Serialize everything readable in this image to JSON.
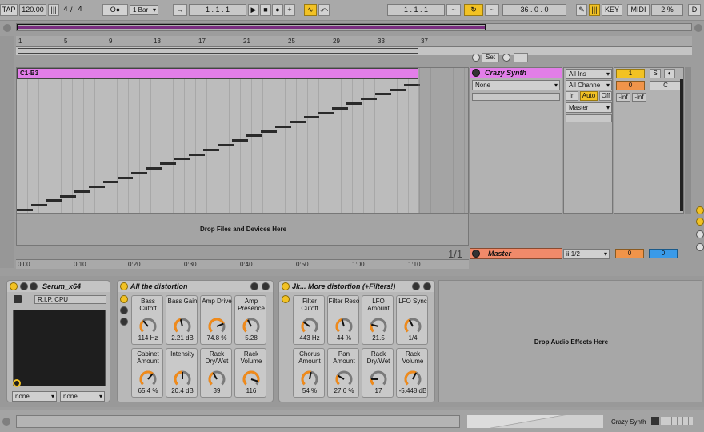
{
  "transport": {
    "tap": "TAP",
    "tempo": "120.00",
    "meter_num": "4",
    "meter_den": "4",
    "metronome": "O●",
    "quantize": "1 Bar",
    "arrangement_pos": "1 .   1 .   1",
    "loop_start": "1 .   1 .   1",
    "loop_length": "36 .   0 .   0",
    "key": "KEY",
    "midi": "MIDI",
    "cpu": "2 %",
    "d": "D"
  },
  "arrangement": {
    "ruler": [
      "1",
      "5",
      "9",
      "13",
      "17",
      "21",
      "25",
      "29",
      "33",
      "37"
    ],
    "clip_name": "C1-B3",
    "drop_text": "Drop Files and Devices Here",
    "time_ruler": [
      "0:00",
      "0:10",
      "0:20",
      "0:30",
      "0:40",
      "0:50",
      "1:00",
      "1:10"
    ],
    "page": "1/1",
    "set_label": "Set"
  },
  "mixer": {
    "track_name": "Crazy Synth",
    "track_color": "#e27ee8",
    "chain_none": "None",
    "input_type": "All Ins",
    "input_channel": "All Channe",
    "monitor_in": "In",
    "monitor_auto": "Auto",
    "monitor_off": "Off",
    "output": "Master",
    "track_number": "1",
    "solo": "S",
    "vol": "0",
    "pan": "C",
    "peak_l": "-inf",
    "peak_r": "-inf",
    "master_name": "Master",
    "master_color": "#f08a6a",
    "master_out": "ii 1/2",
    "master_vol": "0",
    "master_pan": "0"
  },
  "devices": {
    "serum": {
      "title": "Serum_x64",
      "preset": "R.I.P. CPU",
      "sel_a": "none",
      "sel_b": "none"
    },
    "rack1": {
      "title": "All the distortion",
      "params": [
        {
          "label": "Bass Cutoff",
          "value": "114 Hz",
          "level": 0.35
        },
        {
          "label": "Bass Gain",
          "value": "2.21 dB",
          "level": 0.45
        },
        {
          "label": "Amp Drive",
          "value": "74.8 %",
          "level": 0.75
        },
        {
          "label": "Amp Presence",
          "value": "5.28",
          "level": 0.4
        },
        {
          "label": "Cabinet Amount",
          "value": "65.4 %",
          "level": 0.65
        },
        {
          "label": "Intensity",
          "value": "20.4 dB",
          "level": 0.5
        },
        {
          "label": "Rack Dry/Wet",
          "value": "39",
          "level": 0.39
        },
        {
          "label": "Rack Volume",
          "value": "116",
          "level": 0.9
        }
      ]
    },
    "rack2": {
      "title": "Jk... More distortion (+Filters!)",
      "params": [
        {
          "label": "Filter Cutoff",
          "value": "443 Hz",
          "level": 0.3
        },
        {
          "label": "Filter Reso",
          "value": "44 %",
          "level": 0.44
        },
        {
          "label": "LFO Amount",
          "value": "21.5",
          "level": 0.22
        },
        {
          "label": "LFO Sync",
          "value": "1/4",
          "level": 0.4
        },
        {
          "label": "Chorus Amount",
          "value": "54 %",
          "level": 0.54
        },
        {
          "label": "Pan Amount",
          "value": "27.6 %",
          "level": 0.28
        },
        {
          "label": "Rack Dry/Wet",
          "value": "17",
          "level": 0.17
        },
        {
          "label": "Rack Volume",
          "value": "-5.448 dB",
          "level": 0.6
        }
      ]
    },
    "drop_effects": "Drop Audio Effects Here"
  },
  "status": {
    "track": "Crazy Synth"
  },
  "colors": {
    "accent": "#f2c224",
    "knob_arc": "#f08a1a",
    "clip": "#e27ee8"
  }
}
